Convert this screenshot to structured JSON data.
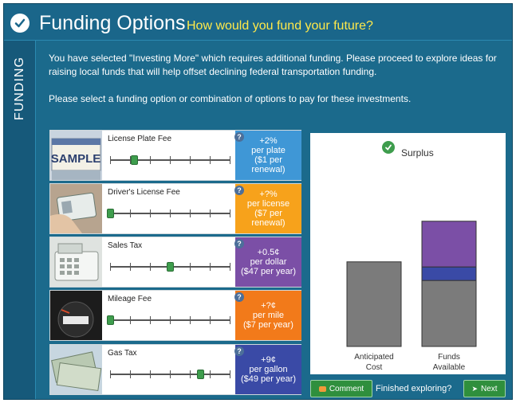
{
  "header": {
    "title": "Funding Options",
    "subtitle": "How would you fund your future?"
  },
  "sidebar": {
    "label": "FUNDING"
  },
  "intro": {
    "line1": "You have selected \"Investing More\" which requires additional funding. Please proceed to explore ideas for raising local funds that will help offset declining federal transportation funding.",
    "line2": "Please select a funding option or combination of options to pay for these investments."
  },
  "options": [
    {
      "name": "License Plate Fee",
      "amount": "+2%",
      "per": "per plate",
      "detail": "($1 per renewal)",
      "color": "#3f97d6",
      "level": 0.2,
      "image_text": "SAMPLE"
    },
    {
      "name": "Driver's License Fee",
      "amount": "+?%",
      "per": "per license",
      "detail": "($7 per renewal)",
      "color": "#f7a21b",
      "level": 0.0
    },
    {
      "name": "Sales Tax",
      "amount": "+0.5¢",
      "per": "per dollar",
      "detail": "($47 per year)",
      "color": "#7b4fa6",
      "level": 0.5
    },
    {
      "name": "Mileage Fee",
      "amount": "+?¢",
      "per": "per mile",
      "detail": "($7 per year)",
      "color": "#f27a1a",
      "level": 0.0
    },
    {
      "name": "Gas Tax",
      "amount": "+9¢",
      "per": "per gallon",
      "detail": "($49 per year)",
      "color": "#3a4aa6",
      "level": 0.75
    }
  ],
  "chart_panel": {
    "surplus_label": "Surplus"
  },
  "chart_data": {
    "type": "bar",
    "categories": [
      "Anticipated Cost",
      "Funds Available"
    ],
    "series": [
      {
        "color": "#7b7b7b",
        "values": [
          100,
          78
        ]
      },
      {
        "color": "#3a4aa6",
        "values": [
          0,
          16
        ]
      },
      {
        "color": "#7b4fa6",
        "values": [
          0,
          54
        ]
      }
    ],
    "ylim": [
      0,
      160
    ],
    "category_lines": [
      [
        "Anticipated",
        "Cost"
      ],
      [
        "Funds",
        "Available"
      ]
    ]
  },
  "footer": {
    "comment_label": "Comment",
    "finished_label": "Finished exploring?",
    "next_label": "Next"
  }
}
